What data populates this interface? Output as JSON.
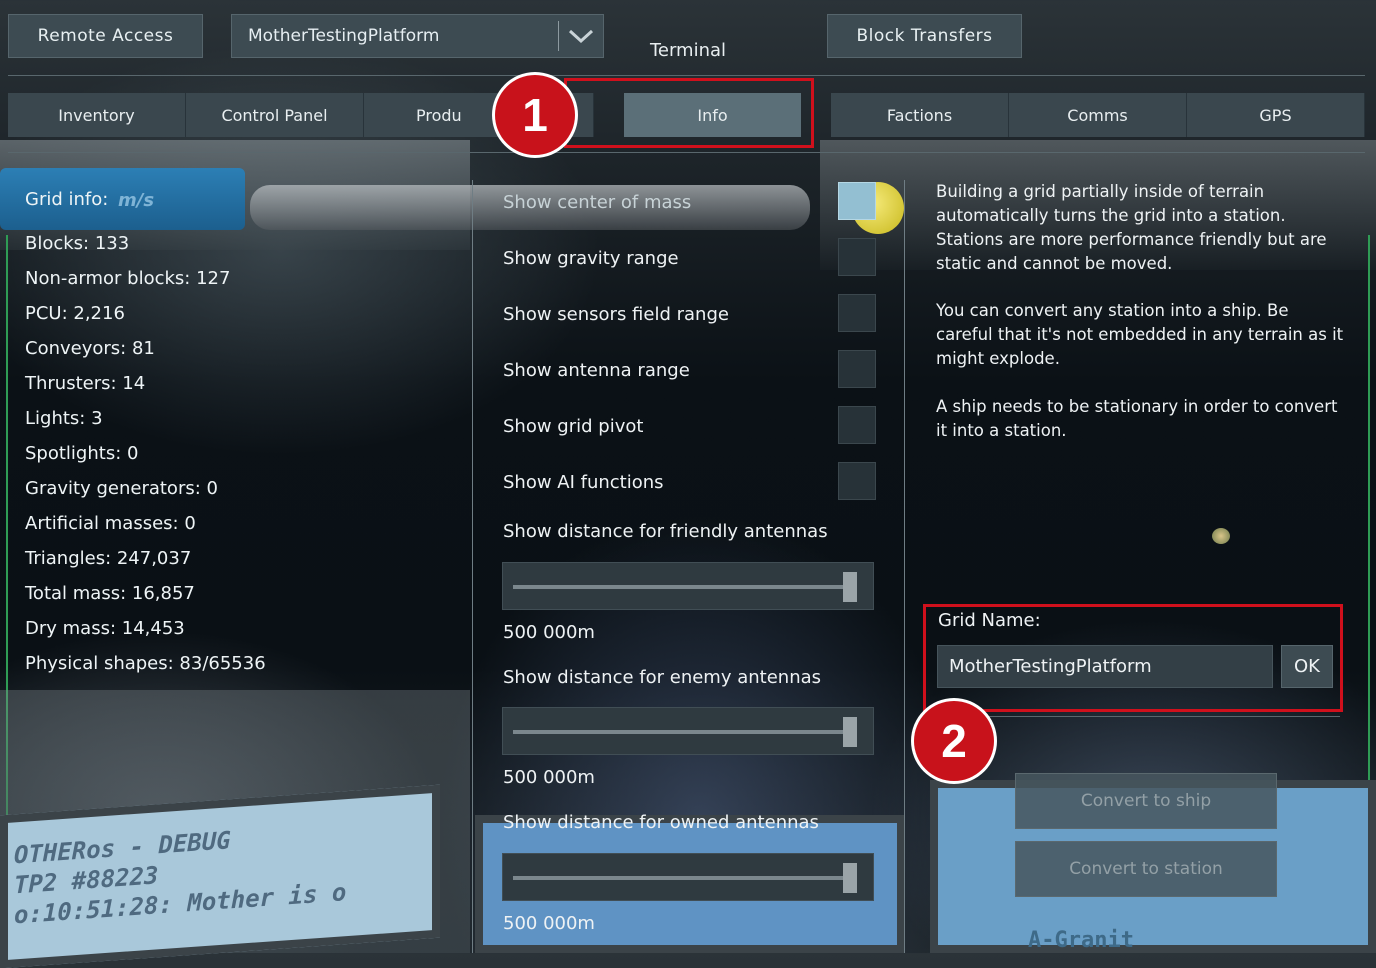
{
  "window": {
    "title": "Terminal",
    "remote_access_label": "Remote Access",
    "grid_selector_value": "MotherTestingPlatform",
    "block_transfers_label": "Block Transfers"
  },
  "tabs": [
    "Inventory",
    "Control Panel",
    "Produ",
    "Info",
    "Factions",
    "Comms",
    "GPS"
  ],
  "active_tab": "Info",
  "annotations": {
    "badge_1": "1",
    "badge_2": "2",
    "color": "#d0101c"
  },
  "grid_info": {
    "header": "Grid info:",
    "stats": [
      "Blocks: 133",
      "Non-armor blocks: 127",
      "PCU: 2,216",
      "Conveyors: 81",
      "Thrusters: 14",
      "Lights: 3",
      "Spotlights: 0",
      "Gravity generators: 0",
      "Artificial masses: 0",
      "Triangles: 247,037",
      "Total mass: 16,857",
      "Dry mass: 14,453",
      "Physical shapes: 83/65536"
    ]
  },
  "options": {
    "checkboxes": [
      {
        "label": "Show center of mass",
        "checked": true
      },
      {
        "label": "Show gravity range",
        "checked": false
      },
      {
        "label": "Show sensors field range",
        "checked": false
      },
      {
        "label": "Show antenna range",
        "checked": false
      },
      {
        "label": "Show grid pivot",
        "checked": false
      },
      {
        "label": "Show AI functions",
        "checked": false
      }
    ],
    "sliders": [
      {
        "label": "Show distance for friendly antennas",
        "value_text": "500 000m",
        "level": 1.0
      },
      {
        "label": "Show distance for enemy antennas",
        "value_text": "500 000m",
        "level": 1.0
      },
      {
        "label": "Show distance for owned antennas",
        "value_text": "500 000m",
        "level": 1.0
      }
    ]
  },
  "info_text": {
    "p1": "Building a grid partially inside of terrain automatically turns the grid into a station. Stations are more performance friendly but are static and cannot be moved.",
    "p2": "You can convert any station into a ship. Be careful that it's not embedded in any terrain as it might explode.",
    "p3": "A ship needs to be stationary in order to convert it into a station."
  },
  "grid_name": {
    "label": "Grid Name:",
    "value": "MotherTestingPlatform",
    "ok_label": "OK"
  },
  "convert": {
    "to_ship_label": "Convert to ship",
    "to_station_label": "Convert to station"
  },
  "background_text": {
    "screen_line1": "OTHERos - DEBUG",
    "screen_line2": "TP2 #88223",
    "screen_line3": "o:10:51:28: Mother is o",
    "screen_right": "A-Granit",
    "speed": "m/s"
  }
}
